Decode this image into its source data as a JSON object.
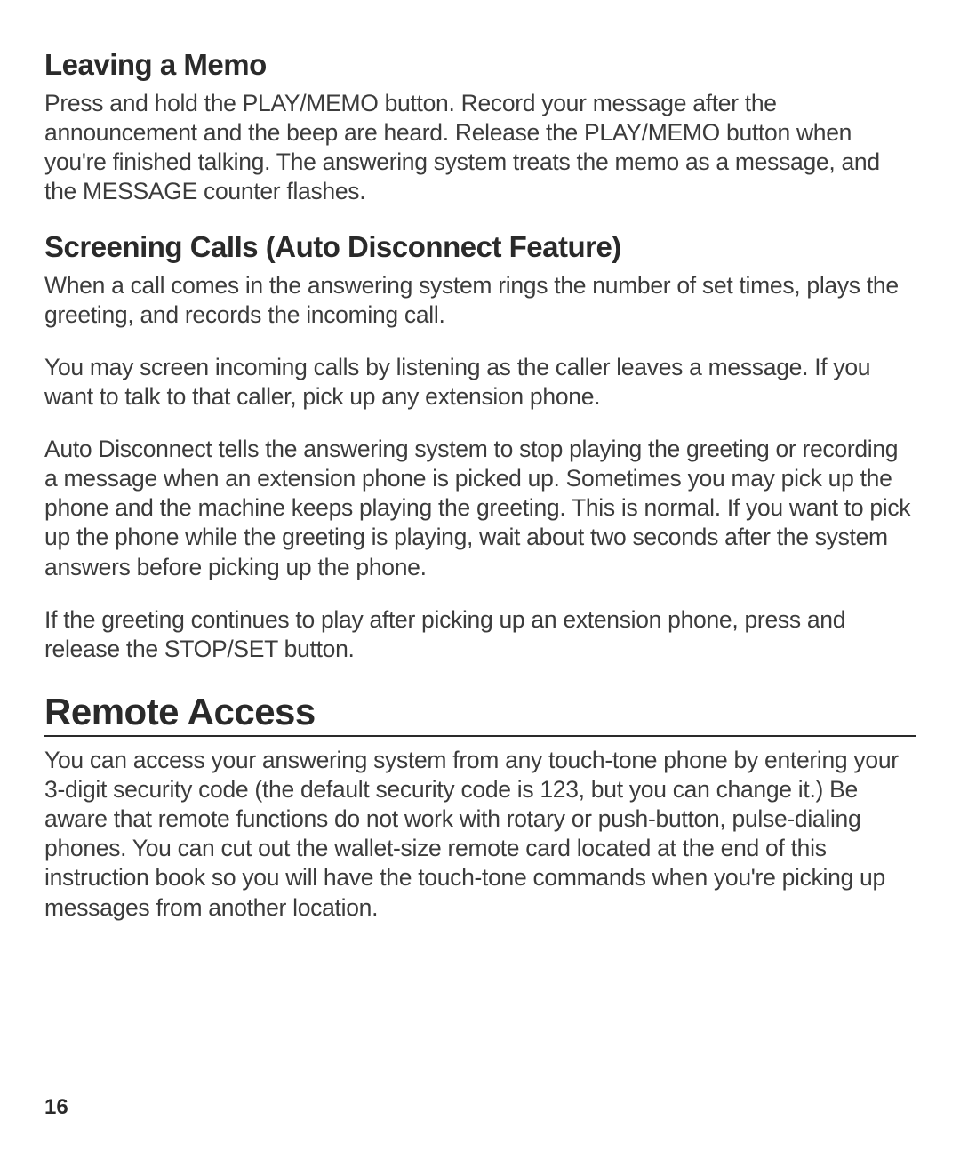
{
  "sections": [
    {
      "heading": "Leaving a Memo",
      "heading_style": "normal",
      "paragraphs": [
        "Press and hold the PLAY/MEMO button. Record your message after the announcement and the beep are heard. Release the PLAY/MEMO button when you're finished talking. The answering system treats the memo as a message, and the MESSAGE counter flashes."
      ]
    },
    {
      "heading": "Screening Calls (Auto Disconnect Feature)",
      "heading_style": "normal",
      "paragraphs": [
        "When a call comes in the answering system rings the number of set times, plays the greeting, and records the incoming call.",
        "You may screen incoming calls by listening as the caller leaves a message. If you want to talk to that caller, pick up any extension phone.",
        "Auto Disconnect tells the answering system to stop playing the greeting or recording a message when an extension phone is picked up. Sometimes you may pick up the phone and the machine keeps playing the greeting. This is normal. If you want to pick up the phone while the greeting is playing, wait about two seconds after the system answers before picking up the phone.",
        "If the greeting continues to play after picking up an extension phone, press and release the STOP/SET button."
      ]
    },
    {
      "heading": "Remote Access",
      "heading_style": "large",
      "paragraphs": [
        "You can access your answering system from any touch-tone phone by entering your 3-digit security code (the default security code is 123, but you can change it.) Be aware that remote functions do not work with rotary or push-button, pulse-dialing phones. You can cut out the wallet-size remote card located at the end of this instruction book so you will have the touch-tone commands when you're picking up messages from another location."
      ]
    }
  ],
  "page_number": "16"
}
